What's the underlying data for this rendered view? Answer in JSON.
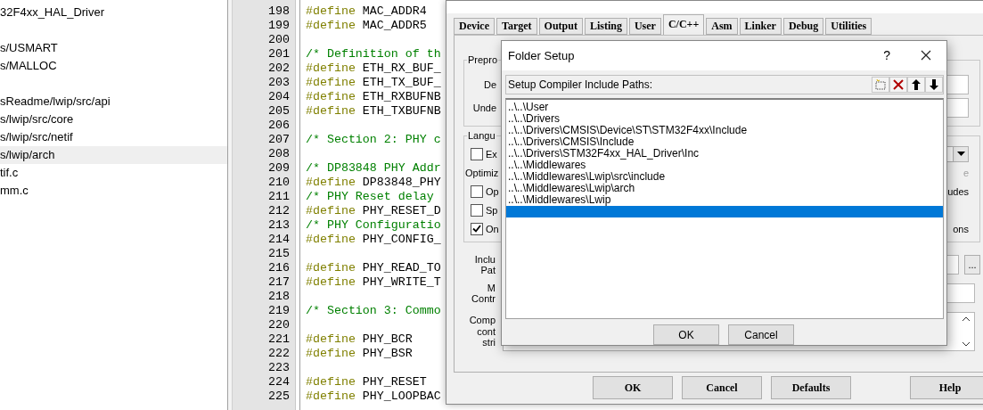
{
  "project_tree": {
    "items": [
      {
        "label": "32F4xx_HAL_Driver",
        "selected": false,
        "gap_before": false
      },
      {
        "label": "s/USMART",
        "selected": false,
        "gap_before": true
      },
      {
        "label": "s/MALLOC",
        "selected": false,
        "gap_before": false
      },
      {
        "label": "sReadme/lwip/src/api",
        "selected": false,
        "gap_before": true
      },
      {
        "label": "s/lwip/src/core",
        "selected": false,
        "gap_before": false
      },
      {
        "label": "s/lwip/src/netif",
        "selected": false,
        "gap_before": false
      },
      {
        "label": "s/lwip/arch",
        "selected": true,
        "gap_before": false
      },
      {
        "label": "tif.c",
        "selected": false,
        "gap_before": false
      },
      {
        "label": "mm.c",
        "selected": false,
        "gap_before": false
      }
    ]
  },
  "editor": {
    "lines": [
      {
        "number": "198",
        "tokens": [
          {
            "kind": "directive",
            "text": "#define"
          },
          {
            "kind": "plain",
            "text": "MAC_ADDR4"
          }
        ]
      },
      {
        "number": "199",
        "tokens": [
          {
            "kind": "directive",
            "text": "#define"
          },
          {
            "kind": "plain",
            "text": "MAC_ADDR5"
          }
        ]
      },
      {
        "number": "200"
      },
      {
        "number": "201",
        "tokens": [
          {
            "kind": "comment",
            "text": "/* Definition of th"
          }
        ]
      },
      {
        "number": "202",
        "tokens": [
          {
            "kind": "directive",
            "text": "#define"
          },
          {
            "kind": "plain",
            "text": "ETH_RX_BUF_"
          }
        ]
      },
      {
        "number": "203",
        "tokens": [
          {
            "kind": "directive",
            "text": "#define"
          },
          {
            "kind": "plain",
            "text": "ETH_TX_BUF_"
          }
        ]
      },
      {
        "number": "204",
        "tokens": [
          {
            "kind": "directive",
            "text": "#define"
          },
          {
            "kind": "plain",
            "text": "ETH_RXBUFNB"
          }
        ]
      },
      {
        "number": "205",
        "tokens": [
          {
            "kind": "directive",
            "text": "#define"
          },
          {
            "kind": "plain",
            "text": "ETH_TXBUFNB"
          }
        ]
      },
      {
        "number": "206"
      },
      {
        "number": "207",
        "tokens": [
          {
            "kind": "comment",
            "text": "/* Section 2: PHY c"
          }
        ]
      },
      {
        "number": "208"
      },
      {
        "number": "209",
        "tokens": [
          {
            "kind": "comment",
            "text": "/* DP83848 PHY Addr"
          }
        ]
      },
      {
        "number": "210",
        "tokens": [
          {
            "kind": "directive",
            "text": "#define"
          },
          {
            "kind": "plain",
            "text": "DP83848_PHY"
          }
        ]
      },
      {
        "number": "211",
        "tokens": [
          {
            "kind": "comment",
            "text": "/* PHY Reset delay"
          }
        ]
      },
      {
        "number": "212",
        "tokens": [
          {
            "kind": "directive",
            "text": "#define"
          },
          {
            "kind": "plain",
            "text": "PHY_RESET_D"
          }
        ]
      },
      {
        "number": "213",
        "tokens": [
          {
            "kind": "comment",
            "text": "/* PHY Configuratio"
          }
        ]
      },
      {
        "number": "214",
        "tokens": [
          {
            "kind": "directive",
            "text": "#define"
          },
          {
            "kind": "plain",
            "text": "PHY_CONFIG_"
          }
        ]
      },
      {
        "number": "215"
      },
      {
        "number": "216",
        "tokens": [
          {
            "kind": "directive",
            "text": "#define"
          },
          {
            "kind": "plain",
            "text": "PHY_READ_TO"
          }
        ]
      },
      {
        "number": "217",
        "tokens": [
          {
            "kind": "directive",
            "text": "#define"
          },
          {
            "kind": "plain",
            "text": "PHY_WRITE_T"
          }
        ]
      },
      {
        "number": "218"
      },
      {
        "number": "219",
        "tokens": [
          {
            "kind": "comment",
            "text": "/* Section 3: Commo"
          }
        ]
      },
      {
        "number": "220"
      },
      {
        "number": "221",
        "tokens": [
          {
            "kind": "directive",
            "text": "#define"
          },
          {
            "kind": "plain",
            "text": "PHY_BCR"
          }
        ]
      },
      {
        "number": "222",
        "tokens": [
          {
            "kind": "directive",
            "text": "#define"
          },
          {
            "kind": "plain",
            "text": "PHY_BSR"
          }
        ]
      },
      {
        "number": "223"
      },
      {
        "number": "224",
        "tokens": [
          {
            "kind": "directive",
            "text": "#define"
          },
          {
            "kind": "plain",
            "text": "PHY_RESET"
          }
        ]
      },
      {
        "number": "225",
        "tokens": [
          {
            "kind": "directive",
            "text": "#define"
          },
          {
            "kind": "plain",
            "text": "PHY_LOOPBAC"
          }
        ]
      }
    ]
  },
  "options_dialog": {
    "tabs": [
      {
        "label": "Device",
        "selected": false
      },
      {
        "label": "Target",
        "selected": false
      },
      {
        "label": "Output",
        "selected": false
      },
      {
        "label": "Listing",
        "selected": false
      },
      {
        "label": "User",
        "selected": false
      },
      {
        "label": "C/C++",
        "selected": true
      },
      {
        "label": "Asm",
        "selected": false
      },
      {
        "label": "Linker",
        "selected": false
      },
      {
        "label": "Debug",
        "selected": false
      },
      {
        "label": "Utilities",
        "selected": false
      }
    ],
    "preprocessor_group": {
      "legend": "Prepro",
      "rows": [
        {
          "label": "De"
        },
        {
          "label": "Unde"
        }
      ]
    },
    "language_group": {
      "legend": "Langu",
      "rows": [
        {
          "kind": "checkbox",
          "label": "Ex",
          "checked": false,
          "trailing": {
            "kind": "dropdown"
          }
        },
        {
          "kind": "label",
          "label": "Optimiz",
          "trailing": {
            "kind": "text",
            "text": "e",
            "disabled": true
          }
        },
        {
          "kind": "checkbox",
          "label": "Op",
          "checked": false,
          "trailing": {
            "kind": "text",
            "text": "udes",
            "disabled": false
          }
        },
        {
          "kind": "checkbox",
          "label": "Sp",
          "checked": false
        },
        {
          "kind": "checkbox",
          "label": "On",
          "checked": true,
          "trailing": {
            "kind": "text",
            "text": "ons",
            "disabled": false
          }
        }
      ]
    },
    "fields": [
      {
        "kind": "include",
        "label_lines": [
          "Inclu",
          "Pat"
        ],
        "button": "..."
      },
      {
        "kind": "input",
        "label_lines": [
          "M",
          "Contr"
        ]
      },
      {
        "kind": "textarea",
        "label_lines": [
          "Comp",
          "cont",
          "stri"
        ]
      }
    ],
    "buttons": [
      "OK",
      "Cancel",
      "Defaults",
      "Help"
    ]
  },
  "folder_setup": {
    "title": "Folder Setup",
    "help": "?",
    "header": "Setup Compiler Include Paths:",
    "paths": [
      "..\\..\\User",
      "..\\..\\Drivers",
      "..\\..\\Drivers\\CMSIS\\Device\\ST\\STM32F4xx\\Include",
      "..\\..\\Drivers\\CMSIS\\Include",
      "..\\..\\Drivers\\STM32F4xx_HAL_Driver\\Inc",
      "..\\..\\Middlewares",
      "..\\..\\Middlewares\\Lwip\\src\\include",
      "..\\..\\Middlewares\\Lwip\\arch",
      "..\\..\\Middlewares\\Lwip"
    ],
    "edit_row": {
      "selected": true
    },
    "buttons": [
      "OK",
      "Cancel"
    ]
  }
}
